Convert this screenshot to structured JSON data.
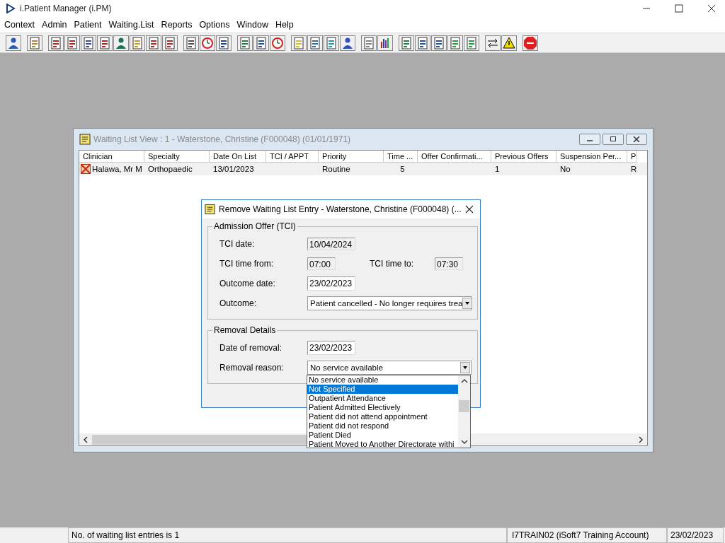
{
  "app": {
    "title": "i.Patient Manager (i.PM)"
  },
  "menu": [
    "Context",
    "Admin",
    "Patient",
    "Waiting.List",
    "Reports",
    "Options",
    "Window",
    "Help"
  ],
  "waiting_list_window": {
    "title": "Waiting List View :  1 - Waterstone, Christine (F000048) (01/01/1971)",
    "columns": [
      "Clinician",
      "Specialty",
      "Date On List",
      "TCI / APPT",
      "Priority",
      "Time ...",
      "Offer Confirmati...",
      "Previous Offers",
      "Suspension Per...",
      "P"
    ],
    "rows": [
      {
        "cells": [
          "Halawa, Mr M",
          "Orthopaedic",
          "13/01/2023",
          "",
          "Routine",
          "5",
          "",
          "1",
          "No",
          "R"
        ]
      }
    ]
  },
  "dialog": {
    "title": "Remove Waiting List Entry - Waterstone, Christine (F000048) (...",
    "admission_offer": {
      "legend": "Admission Offer (TCI)",
      "tci_date_label": "TCI date:",
      "tci_date": "10/04/2024",
      "tci_time_from_label": "TCI time from:",
      "tci_time_from": "07:00",
      "tci_time_to_label": "TCI time to:",
      "tci_time_to": "07:30",
      "outcome_date_label": "Outcome date:",
      "outcome_date": "23/02/2023",
      "outcome_label": "Outcome:",
      "outcome": "Patient cancelled - No longer requires trea"
    },
    "removal_details": {
      "legend": "Removal Details",
      "date_of_removal_label": "Date of removal:",
      "date_of_removal": "23/02/2023",
      "removal_reason_label": "Removal reason:",
      "removal_reason": "No service available",
      "options": [
        {
          "label": "No service available",
          "selected": false
        },
        {
          "label": "Not Specified",
          "selected": true
        },
        {
          "label": "Outpatient Attendance",
          "selected": false
        },
        {
          "label": "Patient Admitted Electively",
          "selected": false
        },
        {
          "label": "Patient did not attend appointment",
          "selected": false
        },
        {
          "label": "Patient did not respond",
          "selected": false
        },
        {
          "label": "Patient Died",
          "selected": false
        },
        {
          "label": "Patient Moved to Another Directorate withi",
          "selected": false
        }
      ]
    }
  },
  "status_bar": [
    "No. of waiting list entries is 1",
    "I7TRAIN02 (iSoft7 Training Account)",
    "23/02/2023"
  ]
}
